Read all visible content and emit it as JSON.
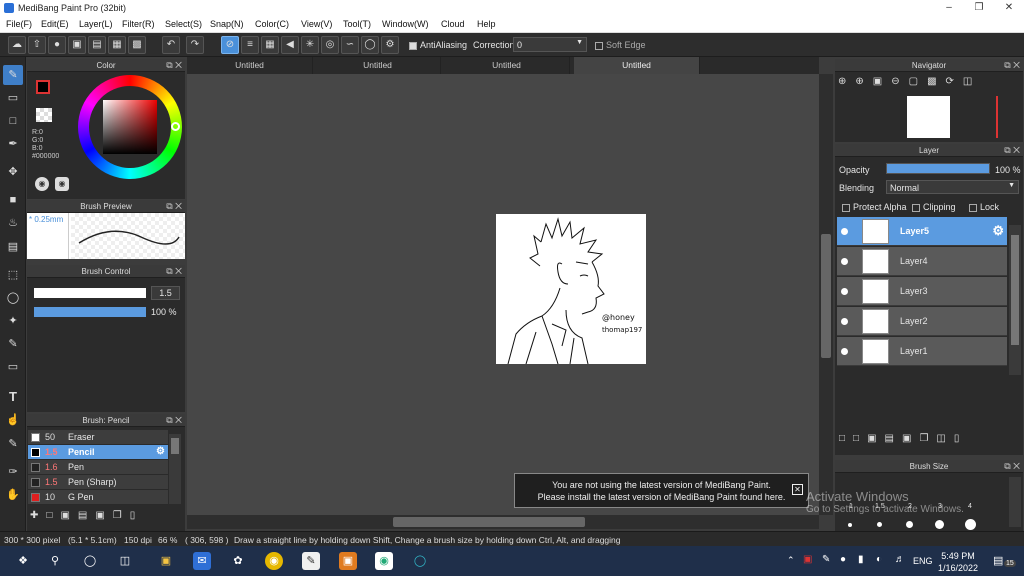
{
  "window": {
    "title": "MediBang Paint Pro (32bit)"
  },
  "menu": [
    "File(F)",
    "Edit(E)",
    "Layer(L)",
    "Filter(R)",
    "Select(S)",
    "Snap(N)",
    "Color(C)",
    "View(V)",
    "Tool(T)",
    "Window(W)",
    "Cloud",
    "Help"
  ],
  "toolbar": {
    "antialiasing": "AntiAliasing",
    "correction_label": "Correction",
    "correction_value": "0",
    "soft_edge": "Soft Edge"
  },
  "tabs": [
    "Untitled",
    "Untitled",
    "Untitled",
    "Untitled"
  ],
  "color_panel": {
    "title": "Color",
    "r": "R:0",
    "g": "G:0",
    "b": "B:0",
    "hex": "#000000"
  },
  "brush_preview": {
    "title": "Brush Preview",
    "size": "0.25mm"
  },
  "brush_control": {
    "title": "Brush Control",
    "size_value": "1.5",
    "opacity_value": "100 %",
    "opacity_level": 1.0
  },
  "brush_list": {
    "title": "Brush: Pencil",
    "items": [
      {
        "size": "50",
        "name": "Eraser",
        "swatch": "#ffffff"
      },
      {
        "size": "1.5",
        "name": "Pencil",
        "swatch": "#000000"
      },
      {
        "size": "1.6",
        "name": "Pen",
        "swatch": "#000000"
      },
      {
        "size": "1.5",
        "name": "Pen (Sharp)",
        "swatch": "#000000"
      },
      {
        "size": "10",
        "name": "G Pen",
        "swatch": "#e02020"
      }
    ]
  },
  "navigator": {
    "title": "Navigator"
  },
  "layer_panel": {
    "title": "Layer",
    "opacity_label": "Opacity",
    "opacity_value": "100 %",
    "opacity_level": 1.0,
    "blending_label": "Blending",
    "blending_value": "Normal",
    "protect_alpha": "Protect Alpha",
    "clipping": "Clipping",
    "lock": "Lock",
    "layers": [
      "Layer5",
      "Layer4",
      "Layer3",
      "Layer2",
      "Layer1"
    ]
  },
  "brush_size": {
    "title": "Brush Size",
    "labels": [
      "1",
      "1.5",
      "2",
      "3",
      "4"
    ]
  },
  "canvas": {
    "signature_line1": "@honey",
    "signature_line2": "thomap197"
  },
  "notification": {
    "line1": "You are not using the latest version of MediBang Paint.",
    "line2": "Please install the latest version of MediBang Paint found here."
  },
  "watermark": {
    "line1": "Activate Windows",
    "line2": "Go to Settings to activate Windows."
  },
  "status": {
    "size": "300 * 300 pixel",
    "physical": "(5.1 * 5.1cm)",
    "dpi": "150 dpi",
    "zoom": "66 %",
    "coords": "( 306, 598 )",
    "hint": "Draw a straight line by holding down Shift, Change a brush size by holding down Ctrl, Alt, and dragging"
  },
  "taskbar": {
    "lang": "ENG",
    "time": "5:49 PM",
    "date": "1/16/2022",
    "notif_count": "15"
  },
  "colors": {
    "accent": "#5b9be0",
    "panel": "#2b2b2b",
    "canvas_bg": "#474747"
  }
}
